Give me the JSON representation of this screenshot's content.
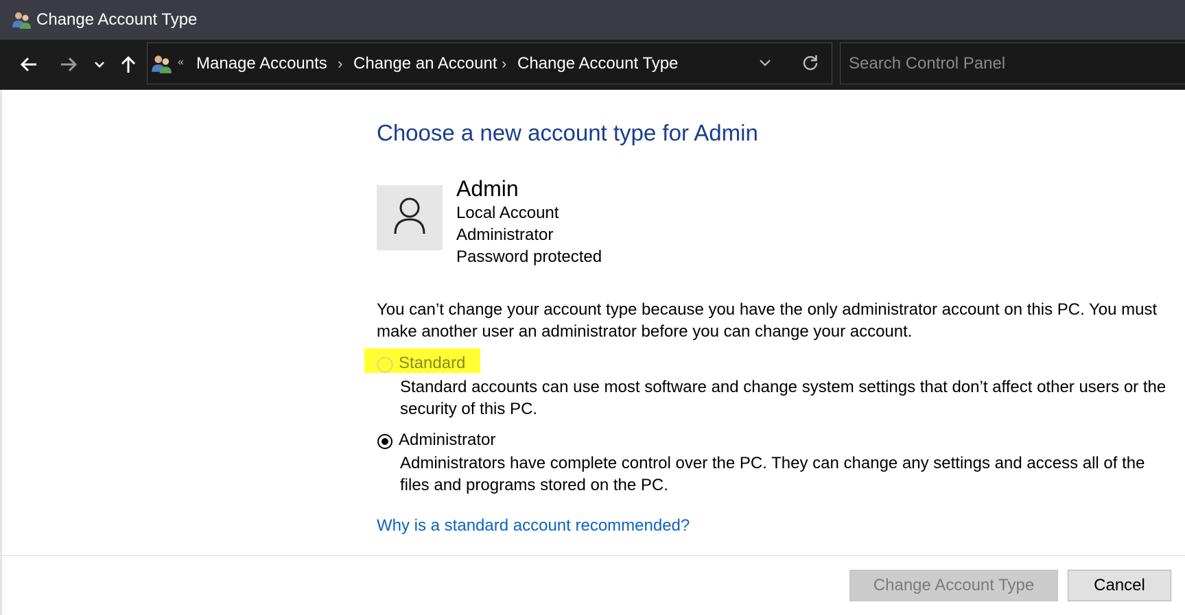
{
  "window": {
    "title": "Change Account Type",
    "app_icon": "users-icon"
  },
  "nav": {
    "back_icon": "back-arrow-icon",
    "forward_icon": "forward-arrow-icon",
    "recent_icon": "chevron-down-icon",
    "up_icon": "up-arrow-icon"
  },
  "address": {
    "icon": "users-icon",
    "overflow": "«",
    "crumbs": [
      "Manage Accounts",
      "Change an Account",
      "Change Account Type"
    ],
    "separator": "›",
    "dropdown_icon": "chevron-down-icon",
    "refresh_icon": "refresh-icon"
  },
  "search": {
    "placeholder": "Search Control Panel",
    "value": ""
  },
  "content": {
    "heading": "Choose a new account type for Admin",
    "user": {
      "name": "Admin",
      "lines": [
        "Local Account",
        "Administrator",
        "Password protected"
      ],
      "avatar_icon": "user-icon"
    },
    "notice": "You can’t change your account type because you have the only administrator account on this PC. You must make another user an administrator before you can change your account.",
    "options": [
      {
        "label": "Standard",
        "description": "Standard accounts can use most software and change system settings that don’t affect other users or the security of this PC.",
        "selected": false,
        "enabled": false
      },
      {
        "label": "Administrator",
        "description": "Administrators have complete control over the PC. They can change any settings and access all of the files and programs stored on the PC.",
        "selected": true,
        "enabled": true
      }
    ],
    "help_link": "Why is a standard account recommended?"
  },
  "footer": {
    "primary_label": "Change Account Type",
    "cancel_label": "Cancel"
  },
  "colors": {
    "titlebar": "#3b3b45",
    "navbar": "#1c1c1c",
    "heading": "#1a3d8f",
    "link": "#0b63c4",
    "highlight": "#ffff33"
  }
}
